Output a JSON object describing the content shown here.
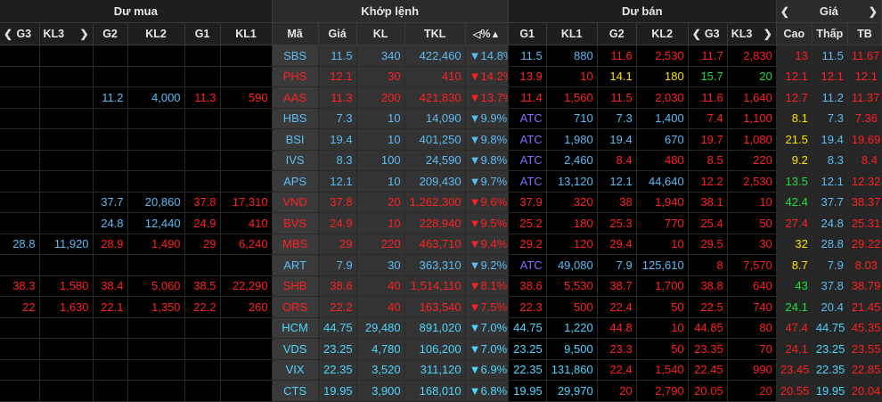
{
  "colors": {
    "red": "#ff2020",
    "blue": "#5bbcf4",
    "yellow": "#ffe000",
    "green": "#1ee036",
    "purple": "#8a6cff",
    "cyan": "#4cd6ff"
  },
  "header": {
    "du_mua": "Dư mua",
    "khop_lenh": "Khớp lệnh",
    "du_ban": "Dư bán",
    "gia": "Giá"
  },
  "columns": {
    "g3": "G3",
    "kl3": "KL3",
    "g2": "G2",
    "kl2": "KL2",
    "g1": "G1",
    "kl1": "KL1",
    "ma": "Mã",
    "gia": "Giá",
    "kl": "KL",
    "tkl": "TKL",
    "pct": "%",
    "sell_g1": "G1",
    "sell_kl1": "KL1",
    "sell_g2": "G2",
    "sell_kl2": "KL2",
    "sell_g3": "G3",
    "sell_kl3": "KL3",
    "cao": "Cao",
    "thap": "Thấp",
    "tb": "TB"
  },
  "rows": [
    {
      "cells": [
        [
          "",
          ""
        ],
        [
          "",
          ""
        ],
        [
          "",
          ""
        ],
        [
          "",
          ""
        ],
        [
          "",
          ""
        ],
        [
          "",
          ""
        ],
        [
          "SBS",
          "blue"
        ],
        [
          "11.5",
          "blue"
        ],
        [
          "340",
          "blue"
        ],
        [
          "422,460",
          "blue"
        ],
        [
          "▼14.8%",
          "blue"
        ],
        [
          "11.5",
          "blue"
        ],
        [
          "880",
          "blue"
        ],
        [
          "11.6",
          "red"
        ],
        [
          "2,530",
          "red"
        ],
        [
          "11.7",
          "red"
        ],
        [
          "2,830",
          "red"
        ],
        [
          "13",
          "red"
        ],
        [
          "11.5",
          "blue"
        ],
        [
          "11.67",
          "red"
        ]
      ]
    },
    {
      "cells": [
        [
          "",
          ""
        ],
        [
          "",
          ""
        ],
        [
          "",
          ""
        ],
        [
          "",
          ""
        ],
        [
          "",
          ""
        ],
        [
          "",
          ""
        ],
        [
          "PHS",
          "red"
        ],
        [
          "12.1",
          "red"
        ],
        [
          "30",
          "red"
        ],
        [
          "410",
          "red"
        ],
        [
          "▼14.2%",
          "red"
        ],
        [
          "13.9",
          "red"
        ],
        [
          "10",
          "red"
        ],
        [
          "14.1",
          "yellow"
        ],
        [
          "180",
          "yellow"
        ],
        [
          "15.7",
          "green"
        ],
        [
          "20",
          "green"
        ],
        [
          "12.1",
          "red"
        ],
        [
          "12.1",
          "red"
        ],
        [
          "12.1",
          "red"
        ]
      ]
    },
    {
      "cells": [
        [
          "",
          ""
        ],
        [
          "",
          ""
        ],
        [
          "11.2",
          "blue"
        ],
        [
          "4,000",
          "blue"
        ],
        [
          "11.3",
          "red"
        ],
        [
          "590",
          "red"
        ],
        [
          "AAS",
          "red"
        ],
        [
          "11.3",
          "red"
        ],
        [
          "200",
          "red"
        ],
        [
          "421,830",
          "red"
        ],
        [
          "▼13.7%",
          "red"
        ],
        [
          "11.4",
          "red"
        ],
        [
          "1,560",
          "red"
        ],
        [
          "11.5",
          "red"
        ],
        [
          "2,030",
          "red"
        ],
        [
          "11.6",
          "red"
        ],
        [
          "1,640",
          "red"
        ],
        [
          "12.7",
          "red"
        ],
        [
          "11.2",
          "blue"
        ],
        [
          "11.37",
          "red"
        ]
      ]
    },
    {
      "cells": [
        [
          "",
          ""
        ],
        [
          "",
          ""
        ],
        [
          "",
          ""
        ],
        [
          "",
          ""
        ],
        [
          "",
          ""
        ],
        [
          "",
          ""
        ],
        [
          "HBS",
          "blue"
        ],
        [
          "7.3",
          "blue"
        ],
        [
          "10",
          "blue"
        ],
        [
          "14,090",
          "blue"
        ],
        [
          "▼9.9%",
          "blue"
        ],
        [
          "ATC",
          "purple"
        ],
        [
          "710",
          "blue"
        ],
        [
          "7.3",
          "blue"
        ],
        [
          "1,400",
          "blue"
        ],
        [
          "7.4",
          "red"
        ],
        [
          "1,100",
          "red"
        ],
        [
          "8.1",
          "yellow"
        ],
        [
          "7.3",
          "blue"
        ],
        [
          "7.36",
          "red"
        ]
      ]
    },
    {
      "cells": [
        [
          "",
          ""
        ],
        [
          "",
          ""
        ],
        [
          "",
          ""
        ],
        [
          "",
          ""
        ],
        [
          "",
          ""
        ],
        [
          "",
          ""
        ],
        [
          "BSI",
          "blue"
        ],
        [
          "19.4",
          "blue"
        ],
        [
          "10",
          "blue"
        ],
        [
          "401,250",
          "blue"
        ],
        [
          "▼9.8%",
          "blue"
        ],
        [
          "ATC",
          "purple"
        ],
        [
          "1,980",
          "blue"
        ],
        [
          "19.4",
          "blue"
        ],
        [
          "670",
          "blue"
        ],
        [
          "19.7",
          "red"
        ],
        [
          "1,080",
          "red"
        ],
        [
          "21.5",
          "yellow"
        ],
        [
          "19.4",
          "blue"
        ],
        [
          "19.69",
          "red"
        ]
      ]
    },
    {
      "cells": [
        [
          "",
          ""
        ],
        [
          "",
          ""
        ],
        [
          "",
          ""
        ],
        [
          "",
          ""
        ],
        [
          "",
          ""
        ],
        [
          "",
          ""
        ],
        [
          "IVS",
          "blue"
        ],
        [
          "8.3",
          "blue"
        ],
        [
          "100",
          "blue"
        ],
        [
          "24,590",
          "blue"
        ],
        [
          "▼9.8%",
          "blue"
        ],
        [
          "ATC",
          "purple"
        ],
        [
          "2,460",
          "blue"
        ],
        [
          "8.4",
          "red"
        ],
        [
          "480",
          "red"
        ],
        [
          "8.5",
          "red"
        ],
        [
          "220",
          "red"
        ],
        [
          "9.2",
          "yellow"
        ],
        [
          "8.3",
          "blue"
        ],
        [
          "8.4",
          "red"
        ]
      ]
    },
    {
      "cells": [
        [
          "",
          ""
        ],
        [
          "",
          ""
        ],
        [
          "",
          ""
        ],
        [
          "",
          ""
        ],
        [
          "",
          ""
        ],
        [
          "",
          ""
        ],
        [
          "APS",
          "blue"
        ],
        [
          "12.1",
          "blue"
        ],
        [
          "10",
          "blue"
        ],
        [
          "209,430",
          "blue"
        ],
        [
          "▼9.7%",
          "blue"
        ],
        [
          "ATC",
          "purple"
        ],
        [
          "13,120",
          "blue"
        ],
        [
          "12.1",
          "blue"
        ],
        [
          "44,640",
          "blue"
        ],
        [
          "12.2",
          "red"
        ],
        [
          "2,530",
          "red"
        ],
        [
          "13.5",
          "green"
        ],
        [
          "12.1",
          "blue"
        ],
        [
          "12.32",
          "red"
        ]
      ]
    },
    {
      "cells": [
        [
          "",
          ""
        ],
        [
          "",
          ""
        ],
        [
          "37.7",
          "blue"
        ],
        [
          "20,860",
          "blue"
        ],
        [
          "37.8",
          "red"
        ],
        [
          "17,310",
          "red"
        ],
        [
          "VND",
          "red"
        ],
        [
          "37.8",
          "red"
        ],
        [
          "20",
          "red"
        ],
        [
          "1,262,300",
          "red"
        ],
        [
          "▼9.6%",
          "red"
        ],
        [
          "37.9",
          "red"
        ],
        [
          "320",
          "red"
        ],
        [
          "38",
          "red"
        ],
        [
          "1,940",
          "red"
        ],
        [
          "38.1",
          "red"
        ],
        [
          "10",
          "red"
        ],
        [
          "42.4",
          "green"
        ],
        [
          "37.7",
          "blue"
        ],
        [
          "38.37",
          "red"
        ]
      ]
    },
    {
      "cells": [
        [
          "",
          ""
        ],
        [
          "",
          ""
        ],
        [
          "24.8",
          "blue"
        ],
        [
          "12,440",
          "blue"
        ],
        [
          "24.9",
          "red"
        ],
        [
          "410",
          "red"
        ],
        [
          "BVS",
          "red"
        ],
        [
          "24.9",
          "red"
        ],
        [
          "10",
          "red"
        ],
        [
          "228,940",
          "red"
        ],
        [
          "▼9.5%",
          "red"
        ],
        [
          "25.2",
          "red"
        ],
        [
          "180",
          "red"
        ],
        [
          "25.3",
          "red"
        ],
        [
          "770",
          "red"
        ],
        [
          "25.4",
          "red"
        ],
        [
          "50",
          "red"
        ],
        [
          "27.4",
          "red"
        ],
        [
          "24.8",
          "blue"
        ],
        [
          "25.31",
          "red"
        ]
      ]
    },
    {
      "cells": [
        [
          "28.8",
          "blue"
        ],
        [
          "11,920",
          "blue"
        ],
        [
          "28.9",
          "red"
        ],
        [
          "1,490",
          "red"
        ],
        [
          "29",
          "red"
        ],
        [
          "6,240",
          "red"
        ],
        [
          "MBS",
          "red"
        ],
        [
          "29",
          "red"
        ],
        [
          "220",
          "red"
        ],
        [
          "463,710",
          "red"
        ],
        [
          "▼9.4%",
          "red"
        ],
        [
          "29.2",
          "red"
        ],
        [
          "120",
          "red"
        ],
        [
          "29.4",
          "red"
        ],
        [
          "10",
          "red"
        ],
        [
          "29.5",
          "red"
        ],
        [
          "30",
          "red"
        ],
        [
          "32",
          "yellow"
        ],
        [
          "28.8",
          "blue"
        ],
        [
          "29.22",
          "red"
        ]
      ]
    },
    {
      "cells": [
        [
          "",
          ""
        ],
        [
          "",
          ""
        ],
        [
          "",
          ""
        ],
        [
          "",
          ""
        ],
        [
          "",
          ""
        ],
        [
          "",
          ""
        ],
        [
          "ART",
          "blue"
        ],
        [
          "7.9",
          "blue"
        ],
        [
          "30",
          "blue"
        ],
        [
          "363,310",
          "blue"
        ],
        [
          "▼9.2%",
          "blue"
        ],
        [
          "ATC",
          "purple"
        ],
        [
          "49,080",
          "blue"
        ],
        [
          "7.9",
          "blue"
        ],
        [
          "125,610",
          "blue"
        ],
        [
          "8",
          "red"
        ],
        [
          "7,570",
          "red"
        ],
        [
          "8.7",
          "yellow"
        ],
        [
          "7.9",
          "blue"
        ],
        [
          "8.03",
          "red"
        ]
      ]
    },
    {
      "cells": [
        [
          "38.3",
          "red"
        ],
        [
          "1,580",
          "red"
        ],
        [
          "38.4",
          "red"
        ],
        [
          "5,060",
          "red"
        ],
        [
          "38.5",
          "red"
        ],
        [
          "22,290",
          "red"
        ],
        [
          "SHB",
          "red"
        ],
        [
          "38.6",
          "red"
        ],
        [
          "40",
          "red"
        ],
        [
          "1,514,110",
          "red"
        ],
        [
          "▼8.1%",
          "red"
        ],
        [
          "38.6",
          "red"
        ],
        [
          "5,530",
          "red"
        ],
        [
          "38.7",
          "red"
        ],
        [
          "1,700",
          "red"
        ],
        [
          "38.8",
          "red"
        ],
        [
          "640",
          "red"
        ],
        [
          "43",
          "green"
        ],
        [
          "37.8",
          "blue"
        ],
        [
          "38.79",
          "red"
        ]
      ]
    },
    {
      "cells": [
        [
          "22",
          "red"
        ],
        [
          "1,630",
          "red"
        ],
        [
          "22.1",
          "red"
        ],
        [
          "1,350",
          "red"
        ],
        [
          "22.2",
          "red"
        ],
        [
          "260",
          "red"
        ],
        [
          "ORS",
          "red"
        ],
        [
          "22.2",
          "red"
        ],
        [
          "40",
          "red"
        ],
        [
          "163,540",
          "red"
        ],
        [
          "▼7.5%",
          "red"
        ],
        [
          "22.3",
          "red"
        ],
        [
          "500",
          "red"
        ],
        [
          "22.4",
          "red"
        ],
        [
          "50",
          "red"
        ],
        [
          "22.5",
          "red"
        ],
        [
          "740",
          "red"
        ],
        [
          "24.1",
          "green"
        ],
        [
          "20.4",
          "blue"
        ],
        [
          "21.45",
          "red"
        ]
      ]
    },
    {
      "cells": [
        [
          "",
          ""
        ],
        [
          "",
          ""
        ],
        [
          "",
          ""
        ],
        [
          "",
          ""
        ],
        [
          "",
          ""
        ],
        [
          "",
          ""
        ],
        [
          "HCM",
          "cyan"
        ],
        [
          "44.75",
          "cyan"
        ],
        [
          "29,480",
          "cyan"
        ],
        [
          "891,020",
          "cyan"
        ],
        [
          "▼7.0%",
          "cyan"
        ],
        [
          "44.75",
          "cyan"
        ],
        [
          "1,220",
          "cyan"
        ],
        [
          "44.8",
          "red"
        ],
        [
          "10",
          "red"
        ],
        [
          "44.85",
          "red"
        ],
        [
          "80",
          "red"
        ],
        [
          "47.4",
          "red"
        ],
        [
          "44.75",
          "cyan"
        ],
        [
          "45.35",
          "red"
        ]
      ]
    },
    {
      "cells": [
        [
          "",
          ""
        ],
        [
          "",
          ""
        ],
        [
          "",
          ""
        ],
        [
          "",
          ""
        ],
        [
          "",
          ""
        ],
        [
          "",
          ""
        ],
        [
          "VDS",
          "cyan"
        ],
        [
          "23.25",
          "cyan"
        ],
        [
          "4,780",
          "cyan"
        ],
        [
          "106,200",
          "cyan"
        ],
        [
          "▼7.0%",
          "cyan"
        ],
        [
          "23.25",
          "cyan"
        ],
        [
          "9,500",
          "cyan"
        ],
        [
          "23.3",
          "red"
        ],
        [
          "50",
          "red"
        ],
        [
          "23.35",
          "red"
        ],
        [
          "70",
          "red"
        ],
        [
          "24.1",
          "red"
        ],
        [
          "23.25",
          "cyan"
        ],
        [
          "23.55",
          "red"
        ]
      ]
    },
    {
      "cells": [
        [
          "",
          ""
        ],
        [
          "",
          ""
        ],
        [
          "",
          ""
        ],
        [
          "",
          ""
        ],
        [
          "",
          ""
        ],
        [
          "",
          ""
        ],
        [
          "VIX",
          "cyan"
        ],
        [
          "22.35",
          "cyan"
        ],
        [
          "3,520",
          "cyan"
        ],
        [
          "311,120",
          "cyan"
        ],
        [
          "▼6.9%",
          "cyan"
        ],
        [
          "22.35",
          "cyan"
        ],
        [
          "131,860",
          "cyan"
        ],
        [
          "22.4",
          "red"
        ],
        [
          "1,540",
          "red"
        ],
        [
          "22.45",
          "red"
        ],
        [
          "990",
          "red"
        ],
        [
          "23.45",
          "red"
        ],
        [
          "22.35",
          "cyan"
        ],
        [
          "22.85",
          "red"
        ]
      ]
    },
    {
      "cells": [
        [
          "",
          ""
        ],
        [
          "",
          ""
        ],
        [
          "",
          ""
        ],
        [
          "",
          ""
        ],
        [
          "",
          ""
        ],
        [
          "",
          ""
        ],
        [
          "CTS",
          "cyan"
        ],
        [
          "19.95",
          "cyan"
        ],
        [
          "3,900",
          "cyan"
        ],
        [
          "168,010",
          "cyan"
        ],
        [
          "▼6.8%",
          "cyan"
        ],
        [
          "19.95",
          "cyan"
        ],
        [
          "29,970",
          "cyan"
        ],
        [
          "20",
          "red"
        ],
        [
          "2,790",
          "red"
        ],
        [
          "20.05",
          "red"
        ],
        [
          "20",
          "red"
        ],
        [
          "20.55",
          "red"
        ],
        [
          "19.95",
          "cyan"
        ],
        [
          "20.04",
          "red"
        ]
      ]
    }
  ]
}
